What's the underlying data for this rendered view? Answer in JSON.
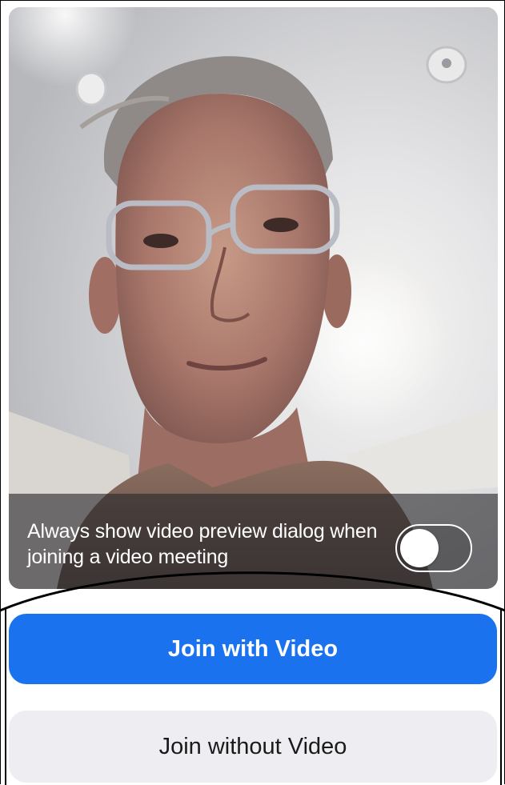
{
  "preview": {
    "toggle_label": "Always show video preview dialog when joining a video meeting",
    "toggle_state": "off"
  },
  "buttons": {
    "join_with_video": "Join with Video",
    "join_without_video": "Join without Video"
  },
  "colors": {
    "primary": "#1a72ee",
    "secondary_bg": "#eeeef2",
    "overlay": "#28282c"
  }
}
